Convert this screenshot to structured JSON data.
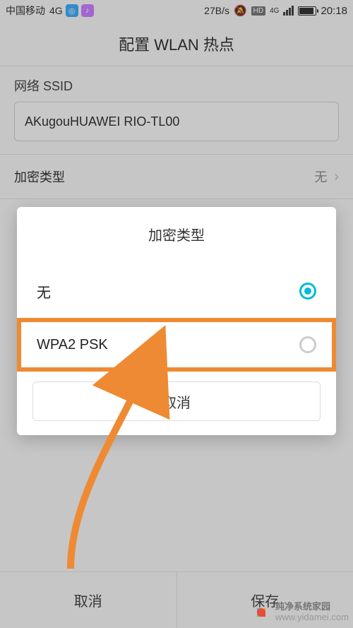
{
  "status": {
    "carrier": "中国移动",
    "network": "4G",
    "speed": "27B/s",
    "hd_label": "HD",
    "net_badge": "4G",
    "time": "20:18"
  },
  "header": {
    "title": "配置 WLAN 热点"
  },
  "ssid": {
    "label": "网络 SSID",
    "value": "AKugouHUAWEI RIO-TL00"
  },
  "encryption_row": {
    "label": "加密类型",
    "value": "无"
  },
  "dialog": {
    "title": "加密类型",
    "options": [
      {
        "label": "无",
        "selected": true
      },
      {
        "label": "WPA2 PSK",
        "selected": false
      }
    ],
    "cancel": "取消"
  },
  "footer": {
    "cancel": "取消",
    "save": "保存"
  },
  "watermark": {
    "line1": "纯净系统家园",
    "line2": "www.yidamei.com"
  }
}
